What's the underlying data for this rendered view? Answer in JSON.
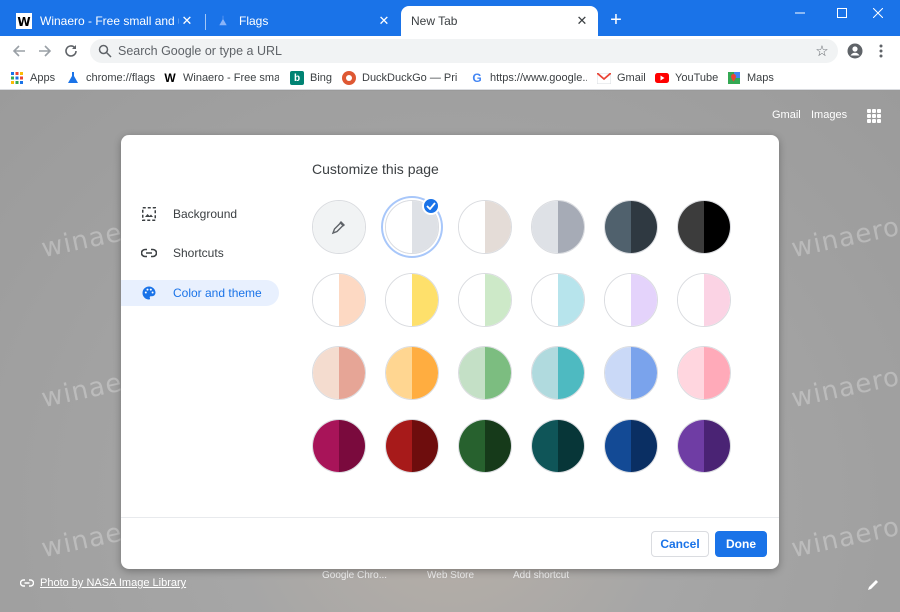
{
  "tabs": [
    {
      "label": "Winaero - Free small and useful software",
      "favicon": "winaero-logo",
      "active": false
    },
    {
      "label": "Flags",
      "favicon": "flags-icon",
      "active": false
    },
    {
      "label": "New Tab",
      "favicon": "",
      "active": true
    }
  ],
  "toolbar": {
    "omnibox_placeholder": "Search Google or type a URL"
  },
  "bookmarks": [
    {
      "label": "Apps",
      "icon": "apps-grid-icon"
    },
    {
      "label": "chrome://flags",
      "icon": "flask-icon"
    },
    {
      "label": "Winaero - Free sma...",
      "icon": "winaero-icon"
    },
    {
      "label": "Bing",
      "icon": "bing-icon"
    },
    {
      "label": "DuckDuckGo — Pri...",
      "icon": "duckduckgo-icon"
    },
    {
      "label": "https://www.google....",
      "icon": "google-icon"
    },
    {
      "label": "Gmail",
      "icon": "gmail-icon"
    },
    {
      "label": "YouTube",
      "icon": "youtube-icon"
    },
    {
      "label": "Maps",
      "icon": "maps-icon"
    }
  ],
  "ntp": {
    "gmail": "Gmail",
    "images": "Images",
    "photo_credit": "Photo by NASA Image Library",
    "shortcuts": [
      "Google Chro...",
      "Web Store",
      "Add shortcut"
    ],
    "watermark": "winaero.com"
  },
  "dialog": {
    "title": "Customize this page",
    "menu": [
      {
        "label": "Background",
        "icon": "image-icon",
        "selected": false
      },
      {
        "label": "Shortcuts",
        "icon": "link-icon",
        "selected": false
      },
      {
        "label": "Color and theme",
        "icon": "palette-icon",
        "selected": true
      }
    ],
    "cancel_label": "Cancel",
    "done_label": "Done",
    "swatches": [
      [
        "custom-color-picker",
        "default",
        "warm-grey",
        "cool-grey",
        "midnight-blue",
        "black"
      ],
      [
        "beige-white",
        "yellow-white",
        "green-white",
        "light-teal-white",
        "light-purple-white",
        "pink-white"
      ],
      [
        "beige",
        "orange",
        "light-green",
        "light-teal",
        "light-blue",
        "pink"
      ],
      [
        "dark-pink-red",
        "dark-red-orange",
        "dark-green",
        "dark-teal",
        "dark-blue",
        "dark-purple"
      ]
    ],
    "swatch_colors": [
      [
        [
          "#f1f3f4",
          "#f1f3f4"
        ],
        [
          "#ffffff",
          "#dee1e6"
        ],
        [
          "#ffffff",
          "#e4dcd7"
        ],
        [
          "#dee1e6",
          "#a6abb6"
        ],
        [
          "#50616d",
          "#2f3941"
        ],
        [
          "#3c3c3c",
          "#000000"
        ]
      ],
      [
        [
          "#ffffff",
          "#fdd9c3"
        ],
        [
          "#ffffff",
          "#fee06b"
        ],
        [
          "#ffffff",
          "#cde9c8"
        ],
        [
          "#ffffff",
          "#b7e4ec"
        ],
        [
          "#ffffff",
          "#e4d3fb"
        ],
        [
          "#ffffff",
          "#fbd3e4"
        ]
      ],
      [
        [
          "#f4dccf",
          "#e6a596"
        ],
        [
          "#ffd691",
          "#ffad40"
        ],
        [
          "#c4e0c6",
          "#7cbd80"
        ],
        [
          "#b0dade",
          "#4ebac1"
        ],
        [
          "#cad9f7",
          "#7aa3ec"
        ],
        [
          "#ffd6df",
          "#ffaab9"
        ]
      ],
      [
        [
          "#a81459",
          "#7a0a3d"
        ],
        [
          "#a71a1a",
          "#6e0d0d"
        ],
        [
          "#27612e",
          "#163a1a"
        ],
        [
          "#0f5558",
          "#073638"
        ],
        [
          "#134a95",
          "#0a2f63"
        ],
        [
          "#6f3da4",
          "#4a2374"
        ]
      ]
    ],
    "selected_swatch": "default"
  }
}
